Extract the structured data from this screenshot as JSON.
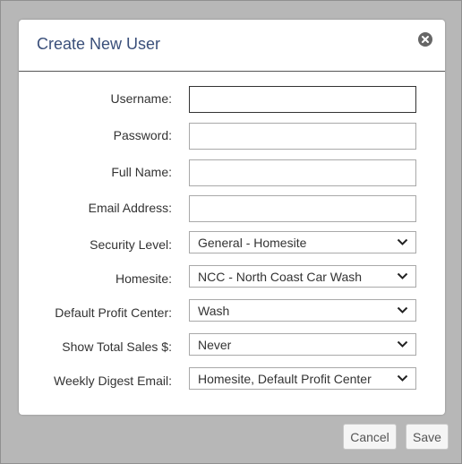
{
  "dialog": {
    "title": "Create New User",
    "close_icon": "close-circle-icon"
  },
  "form": {
    "username": {
      "label": "Username:",
      "value": ""
    },
    "password": {
      "label": "Password:",
      "value": ""
    },
    "full_name": {
      "label": "Full Name:",
      "value": ""
    },
    "email": {
      "label": "Email Address:",
      "value": ""
    },
    "security_level": {
      "label": "Security Level:",
      "value": "General - Homesite"
    },
    "homesite": {
      "label": "Homesite:",
      "value": "NCC - North Coast Car Wash"
    },
    "default_profit_center": {
      "label": "Default Profit Center:",
      "value": "Wash"
    },
    "show_total_sales": {
      "label": "Show Total Sales $:",
      "value": "Never"
    },
    "weekly_digest_email": {
      "label": "Weekly Digest Email:",
      "value": "Homesite, Default Profit Center"
    }
  },
  "buttons": {
    "cancel": "Cancel",
    "save": "Save"
  },
  "colors": {
    "title": "#3a4f7a",
    "backdrop": "#b7b7b7",
    "modal": "#ffffff"
  }
}
